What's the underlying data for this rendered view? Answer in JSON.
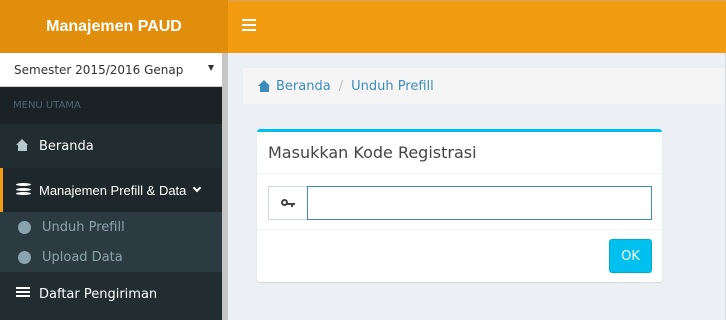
{
  "app": {
    "title": "Manajemen PAUD"
  },
  "sidebar": {
    "semester_select": {
      "value": "Semester 2015/2016 Genap"
    },
    "menu_header": "MENU UTAMA",
    "items": [
      {
        "label": "Beranda",
        "icon": "home-icon"
      },
      {
        "label": "Manajemen Prefill & Data",
        "icon": "database-icon",
        "expanded": true
      },
      {
        "label": "Daftar Pengiriman",
        "icon": "list-icon"
      }
    ],
    "submenu": [
      {
        "label": "Unduh Prefill",
        "icon": "circle-arrow-down-icon"
      },
      {
        "label": "Upload Data",
        "icon": "circle-arrow-up-icon"
      }
    ]
  },
  "breadcrumb": {
    "home": "Beranda",
    "separator": "/",
    "current": "Unduh Prefill"
  },
  "box": {
    "title": "Masukkan Kode Registrasi",
    "input": {
      "value": "",
      "placeholder": ""
    },
    "ok_label": "OK"
  },
  "colors": {
    "header": "#f39c12",
    "logo": "#e08e0b",
    "sidebar": "#222d32",
    "accent": "#00c0ef",
    "link": "#3c8dbc"
  }
}
